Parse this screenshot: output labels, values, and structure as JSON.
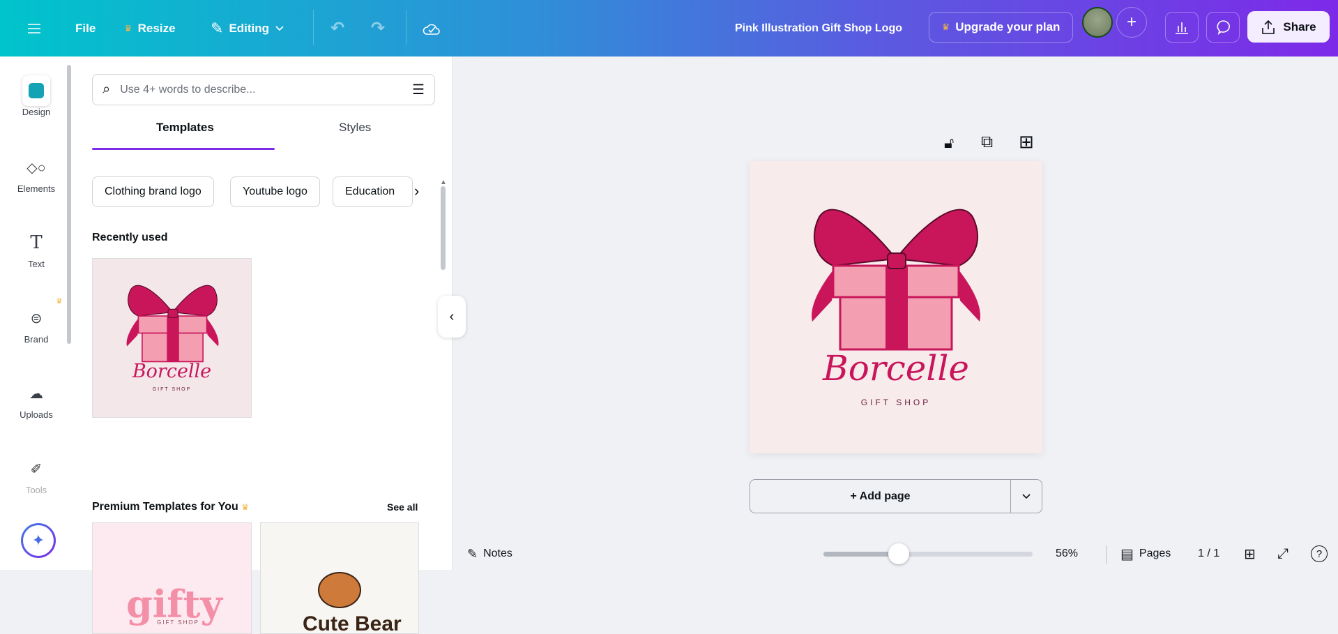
{
  "header": {
    "file": "File",
    "resize": "Resize",
    "editing": "Editing",
    "title": "Pink Illustration Gift Shop Logo",
    "upgrade": "Upgrade your plan",
    "share": "Share"
  },
  "rail": [
    {
      "label": "Design"
    },
    {
      "label": "Elements"
    },
    {
      "label": "Text"
    },
    {
      "label": "Brand"
    },
    {
      "label": "Uploads"
    },
    {
      "label": "Tools"
    }
  ],
  "panel": {
    "search_placeholder": "Use 4+ words to describe...",
    "tabs": [
      "Templates",
      "Styles"
    ],
    "chips": [
      "Clothing brand logo",
      "Youtube logo",
      "Education"
    ],
    "recent": "Recently used",
    "premium": "Premium Templates for You",
    "see_all": "See all"
  },
  "design": {
    "brand": "Borcelle",
    "sub": "GIFT SHOP"
  },
  "thumbs": {
    "gifty": "gifty",
    "gifty_sub": "GIFT SHOP",
    "bear": "Cute Bear"
  },
  "canvas": {
    "add_page": "+ Add page"
  },
  "footer": {
    "notes": "Notes",
    "zoom": "56%",
    "zoom_value": 56,
    "pages": "Pages",
    "page_count": "1 / 1"
  },
  "colors": {
    "accent": "#7d2ae8",
    "bow": "#c9165b",
    "box": "#f49fb1"
  }
}
